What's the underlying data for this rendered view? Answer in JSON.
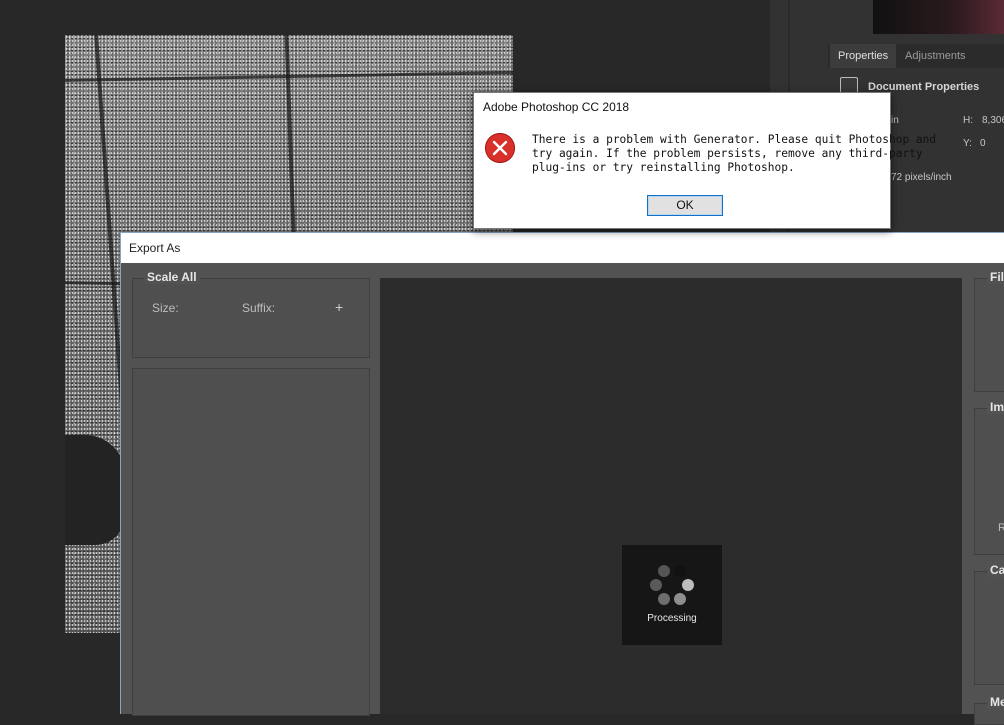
{
  "panel": {
    "tabs": [
      {
        "label": "Properties",
        "active": true
      },
      {
        "label": "Adjustments",
        "active": false
      }
    ],
    "doc_props_label": "Document Properties",
    "w_label_partial": "in",
    "h_label": "H:",
    "h_value": "8,306",
    "y_label": "Y:",
    "y_value": "0",
    "resolution": "72 pixels/inch"
  },
  "export": {
    "title": "Export As",
    "scale_all": "Scale All",
    "size_label": "Size:",
    "suffix_label": "Suffix:",
    "add_icon": "+",
    "right_sections": [
      "File",
      "Ima",
      "Ca",
      "Me"
    ],
    "right_partial_text": "R",
    "processing_label": "Processing"
  },
  "alert": {
    "title": "Adobe Photoshop CC 2018",
    "lines": [
      "There is a problem with Generator. Please quit Photoshop and",
      "try again. If the problem persists, remove any third-party",
      "plug-ins or try reinstalling Photoshop."
    ],
    "ok_label": "OK",
    "icon": "error-icon"
  }
}
